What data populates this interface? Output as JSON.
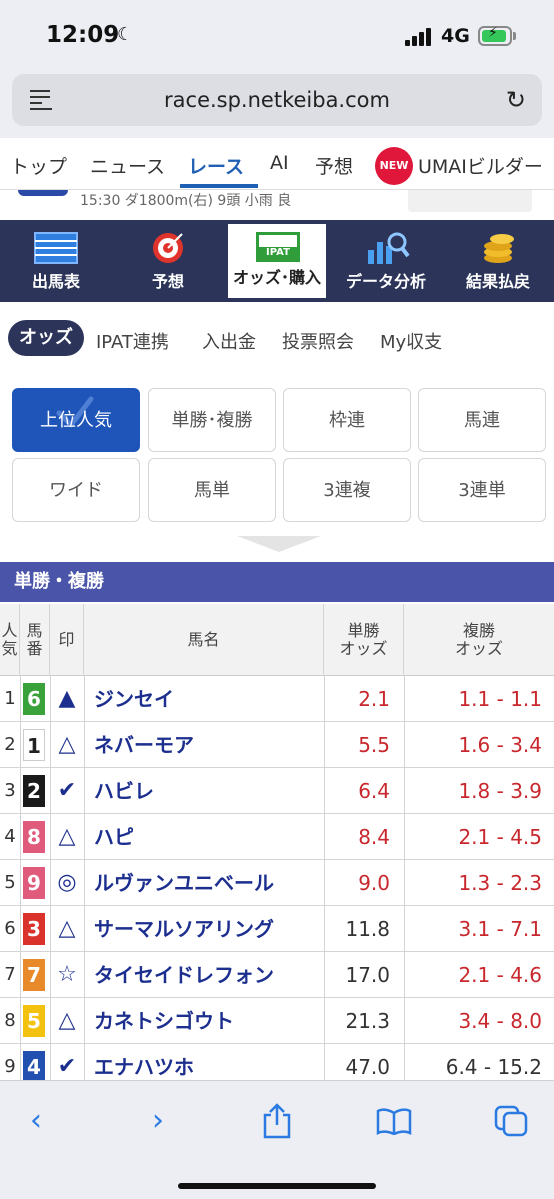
{
  "status": {
    "time": "12:09",
    "network": "4G"
  },
  "browser": {
    "url": "race.sp.netkeiba.com"
  },
  "nav_tabs": [
    {
      "label": "トップ"
    },
    {
      "label": "ニュース"
    },
    {
      "label": "レース"
    },
    {
      "label": "AI"
    },
    {
      "label": "予想"
    },
    {
      "label": "UMAIビルダー"
    }
  ],
  "new_badge": "NEW",
  "race_info": "15:30 ダ1800m(右) 9頭 小雨 良",
  "icon_menu": [
    {
      "label": "出馬表",
      "icon": "entry-table-icon"
    },
    {
      "label": "予想",
      "icon": "target-icon"
    },
    {
      "label": "オッズ･購入",
      "icon": "ipat-icon"
    },
    {
      "label": "データ分析",
      "icon": "chart-search-icon"
    },
    {
      "label": "結果払戻",
      "icon": "coins-icon"
    }
  ],
  "ipat_icon_text": "IPAT",
  "sub_menu": [
    {
      "label": "オッズ"
    },
    {
      "label": "IPAT連携"
    },
    {
      "label": "入出金"
    },
    {
      "label": "投票照会"
    },
    {
      "label": "My収支"
    }
  ],
  "bet_types": [
    {
      "label": "上位人気"
    },
    {
      "label": "単勝･複勝"
    },
    {
      "label": "枠連"
    },
    {
      "label": "馬連"
    },
    {
      "label": "ワイド"
    },
    {
      "label": "馬単"
    },
    {
      "label": "3連複"
    },
    {
      "label": "3連単"
    }
  ],
  "section_title": "単勝・複勝",
  "table": {
    "headers": {
      "popularity": "人\n気",
      "number": "馬\n番",
      "mark": "印",
      "name": "馬名",
      "win": "単勝\nオッズ",
      "place": "複勝\nオッズ"
    },
    "rows": [
      {
        "pop": "1",
        "num": "6",
        "mark": "▲",
        "name": "ジンセイ",
        "win": "2.1",
        "place": "1.1 - 1.1",
        "frame_color": "#3aa23a",
        "num_color": "#ffffff",
        "win_red": true,
        "place_red": true
      },
      {
        "pop": "2",
        "num": "1",
        "mark": "△",
        "name": "ネバーモア",
        "win": "5.5",
        "place": "1.6 - 3.4",
        "frame_color": "#ffffff",
        "num_color": "#222222",
        "win_red": true,
        "place_red": true
      },
      {
        "pop": "3",
        "num": "2",
        "mark": "✔",
        "name": "ハビレ",
        "win": "6.4",
        "place": "1.8 - 3.9",
        "frame_color": "#1a1a1a",
        "num_color": "#ffffff",
        "win_red": true,
        "place_red": true
      },
      {
        "pop": "4",
        "num": "8",
        "mark": "△",
        "name": "ハピ",
        "win": "8.4",
        "place": "2.1 - 4.5",
        "frame_color": "#e05a7c",
        "num_color": "#ffffff",
        "win_red": true,
        "place_red": true
      },
      {
        "pop": "5",
        "num": "9",
        "mark": "◎",
        "name": "ルヴァンユニベール",
        "win": "9.0",
        "place": "1.3 - 2.3",
        "frame_color": "#e05a7c",
        "num_color": "#ffffff",
        "win_red": true,
        "place_red": true
      },
      {
        "pop": "6",
        "num": "3",
        "mark": "△",
        "name": "サーマルソアリング",
        "win": "11.8",
        "place": "3.1 - 7.1",
        "frame_color": "#d9332b",
        "num_color": "#ffffff",
        "win_red": false,
        "place_red": true
      },
      {
        "pop": "7",
        "num": "7",
        "mark": "☆",
        "name": "タイセイドレフォン",
        "win": "17.0",
        "place": "2.1 - 4.6",
        "frame_color": "#e8892a",
        "num_color": "#ffffff",
        "win_red": false,
        "place_red": true
      },
      {
        "pop": "8",
        "num": "5",
        "mark": "△",
        "name": "カネトシゴウト",
        "win": "21.3",
        "place": "3.4 - 8.0",
        "frame_color": "#f2c20f",
        "num_color": "#ffffff",
        "win_red": false,
        "place_red": true
      },
      {
        "pop": "9",
        "num": "4",
        "mark": "✔",
        "name": "エナハツホ",
        "win": "47.0",
        "place": "6.4 - 15.2",
        "frame_color": "#2150b0",
        "num_color": "#ffffff",
        "win_red": false,
        "place_red": false
      }
    ]
  },
  "colors": {
    "accent": "#1f5fb4",
    "menu_bg": "#2c3559",
    "odds_red": "#c8282d",
    "section_bg": "#4a54a8"
  }
}
